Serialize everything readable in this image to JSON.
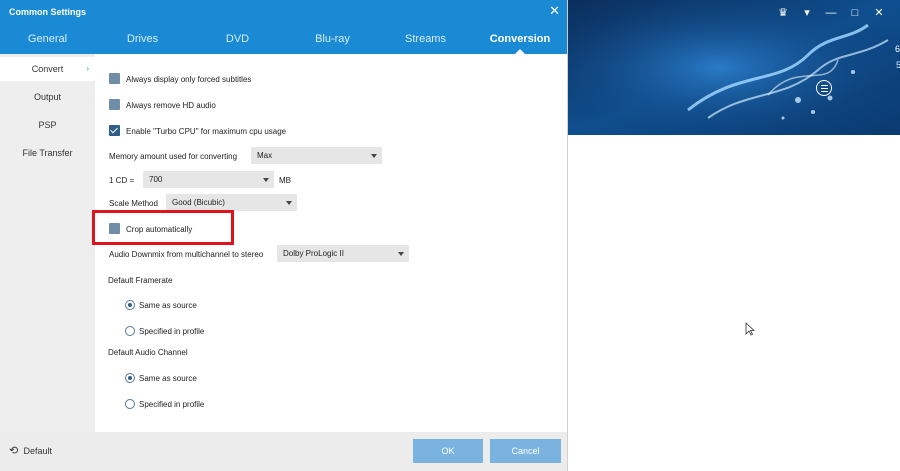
{
  "dialog": {
    "title": "Common Settings",
    "close_icon": "✕"
  },
  "tabs": [
    {
      "label": "General"
    },
    {
      "label": "Drives"
    },
    {
      "label": "DVD"
    },
    {
      "label": "Blu-ray"
    },
    {
      "label": "Streams"
    },
    {
      "label": "Conversion",
      "active": true
    }
  ],
  "sidebar": {
    "items": [
      {
        "label": "Convert",
        "active": true
      },
      {
        "label": "Output"
      },
      {
        "label": "PSP"
      },
      {
        "label": "File Transfer"
      }
    ]
  },
  "options": {
    "forced_subtitles": {
      "label": "Always display only forced subtitles",
      "checked": false
    },
    "remove_hd_audio": {
      "label": "Always remove HD audio",
      "checked": false
    },
    "turbo_cpu": {
      "label": "Enable \"Turbo CPU\" for maximum cpu usage",
      "checked": true
    },
    "memory": {
      "label": "Memory amount used for converting",
      "value": "Max"
    },
    "cd_size": {
      "label": "1 CD =",
      "value": "700",
      "unit": "MB"
    },
    "scale_method": {
      "label": "Scale Method",
      "value": "Good (Bicubic)"
    },
    "crop_auto": {
      "label": "Crop automatically",
      "checked": false
    },
    "audio_downmix": {
      "label": "Audio Downmix from multichannel to stereo",
      "value": "Dolby ProLogic II"
    },
    "framerate": {
      "heading": "Default Framerate",
      "options": [
        {
          "label": "Same as source",
          "selected": true
        },
        {
          "label": "Specified in profile",
          "selected": false
        }
      ]
    },
    "audio_channel": {
      "heading": "Default Audio Channel",
      "options": [
        {
          "label": "Same as source",
          "selected": true
        },
        {
          "label": "Specified in profile",
          "selected": false
        }
      ]
    }
  },
  "footer": {
    "default_label": "Default",
    "ok_label": "OK",
    "cancel_label": "Cancel"
  },
  "colors": {
    "accent": "#1a8ad4",
    "highlight": "#e0121c",
    "button": "#7ab3e0"
  },
  "bgapp": {
    "edge_text": "6",
    "edge_text2": "5"
  }
}
